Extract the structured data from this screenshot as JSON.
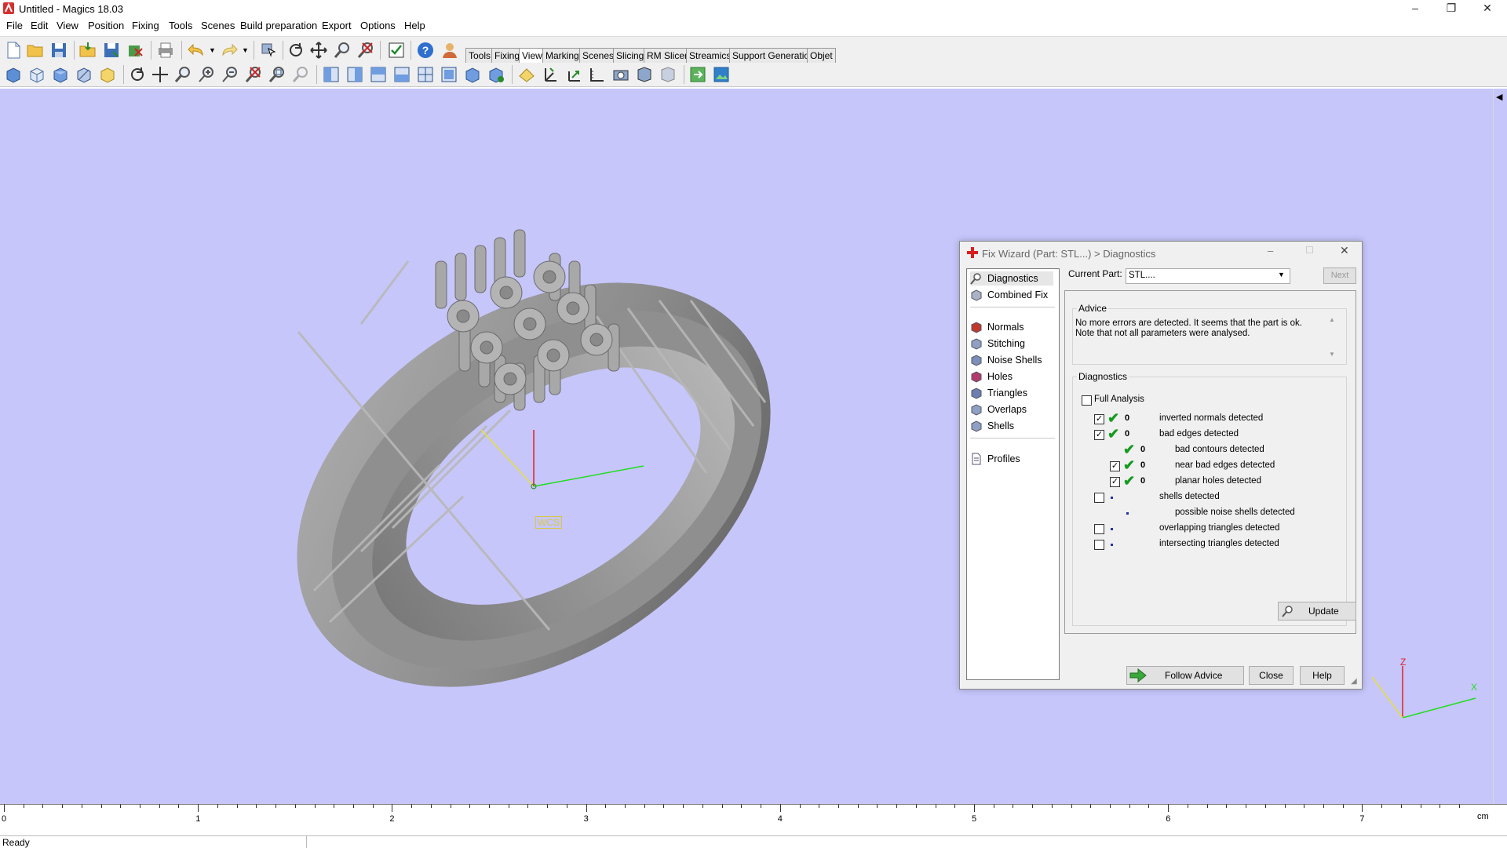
{
  "window": {
    "title": "Untitled - Magics 18.03"
  },
  "menu": [
    "File",
    "Edit",
    "View",
    "Position",
    "Fixing",
    "Tools",
    "Scenes",
    "Build preparation",
    "Export",
    "Options",
    "Help"
  ],
  "toolbar_tabs": [
    "Tools",
    "Fixing",
    "View",
    "Marking",
    "Scenes",
    "Slicing",
    "RM Slicer",
    "Streamics",
    "Support Generation",
    "Objet"
  ],
  "active_tab": "View",
  "toolbar1_icons": [
    "new-file-icon",
    "open-folder-icon",
    "save-icon",
    "import-icon",
    "save-as-icon",
    "remove-part-icon",
    "print-icon",
    "undo-icon",
    "redo-icon",
    "select-icon",
    "rotate-icon",
    "pan-icon",
    "zoom-icon",
    "zoom-window-icon",
    "checklist-icon",
    "help-icon",
    "user-icon"
  ],
  "toolbar2_icons": [
    "shaded-view-icon",
    "wireframe-view-icon",
    "solid-view-icon",
    "transparent-view-icon",
    "box-view-icon",
    "rotate-view-icon",
    "move-view-icon",
    "zoom-in-icon",
    "zoom-plus-icon",
    "zoom-minus-icon",
    "zoom-fit-icon",
    "zoom-all-icon",
    "zoom-selection-icon",
    "front-view-icon",
    "back-view-icon",
    "left-view-icon",
    "right-view-icon",
    "top-view-icon",
    "bottom-view-icon",
    "iso-view-icon",
    "perspective-view-icon",
    "section-icon",
    "axes-icon",
    "measure-icon",
    "ruler-icon",
    "camera-icon",
    "camera2-icon",
    "camera3-icon",
    "export-view-icon",
    "screenshot-icon"
  ],
  "viewport": {
    "wcs_label": "WCS",
    "mini_axes": {
      "x": "X",
      "z": "Z"
    }
  },
  "ruler": {
    "ticks": [
      "0",
      "1",
      "2",
      "3",
      "4",
      "5",
      "6",
      "7"
    ],
    "unit": "cm"
  },
  "status": "Ready",
  "dialog": {
    "title": "Fix Wizard (Part: STL...) > Diagnostics",
    "nav": {
      "top": [
        {
          "label": "Diagnostics",
          "icon": "magnifier-icon"
        },
        {
          "label": "Combined Fix",
          "icon": "cube-icon"
        }
      ],
      "fixes": [
        {
          "label": "Normals",
          "icon": "normals-icon"
        },
        {
          "label": "Stitching",
          "icon": "stitching-icon"
        },
        {
          "label": "Noise Shells",
          "icon": "noise-shells-icon"
        },
        {
          "label": "Holes",
          "icon": "holes-icon"
        },
        {
          "label": "Triangles",
          "icon": "triangles-icon"
        },
        {
          "label": "Overlaps",
          "icon": "overlaps-icon"
        },
        {
          "label": "Shells",
          "icon": "shells-icon"
        }
      ],
      "bottom": [
        {
          "label": "Profiles",
          "icon": "document-icon"
        }
      ]
    },
    "current_part_label": "Current Part:",
    "current_part_value": "STL....",
    "next_button": "Next",
    "advice_title": "Advice",
    "advice_text": "No more errors are detected. It seems that the part is ok. Note that not all parameters were analysed.",
    "diagnostics_title": "Diagnostics",
    "full_analysis_label": "Full Analysis",
    "rows": [
      {
        "checkbox": true,
        "checked": true,
        "status": "ok",
        "count": "0",
        "label": "inverted normals detected",
        "indent": 0
      },
      {
        "checkbox": true,
        "checked": true,
        "status": "ok",
        "count": "0",
        "label": "bad edges detected",
        "indent": 0
      },
      {
        "checkbox": false,
        "checked": false,
        "status": "ok",
        "count": "0",
        "label": "bad contours detected",
        "indent": 1
      },
      {
        "checkbox": true,
        "checked": true,
        "status": "ok",
        "count": "0",
        "label": "near bad edges detected",
        "indent": 1
      },
      {
        "checkbox": true,
        "checked": true,
        "status": "ok",
        "count": "0",
        "label": "planar holes detected",
        "indent": 1
      },
      {
        "checkbox": true,
        "checked": false,
        "status": "dot",
        "count": "",
        "label": "shells detected",
        "indent": 0
      },
      {
        "checkbox": false,
        "checked": false,
        "status": "dot",
        "count": "",
        "label": "possible noise shells detected",
        "indent": 1
      },
      {
        "checkbox": true,
        "checked": false,
        "status": "dot",
        "count": "",
        "label": "overlapping triangles detected",
        "indent": 0
      },
      {
        "checkbox": true,
        "checked": false,
        "status": "dot",
        "count": "",
        "label": "intersecting triangles detected",
        "indent": 0
      }
    ],
    "update_button": "Update",
    "follow_advice_button": "Follow Advice",
    "close_button": "Close",
    "help_button": "Help"
  }
}
